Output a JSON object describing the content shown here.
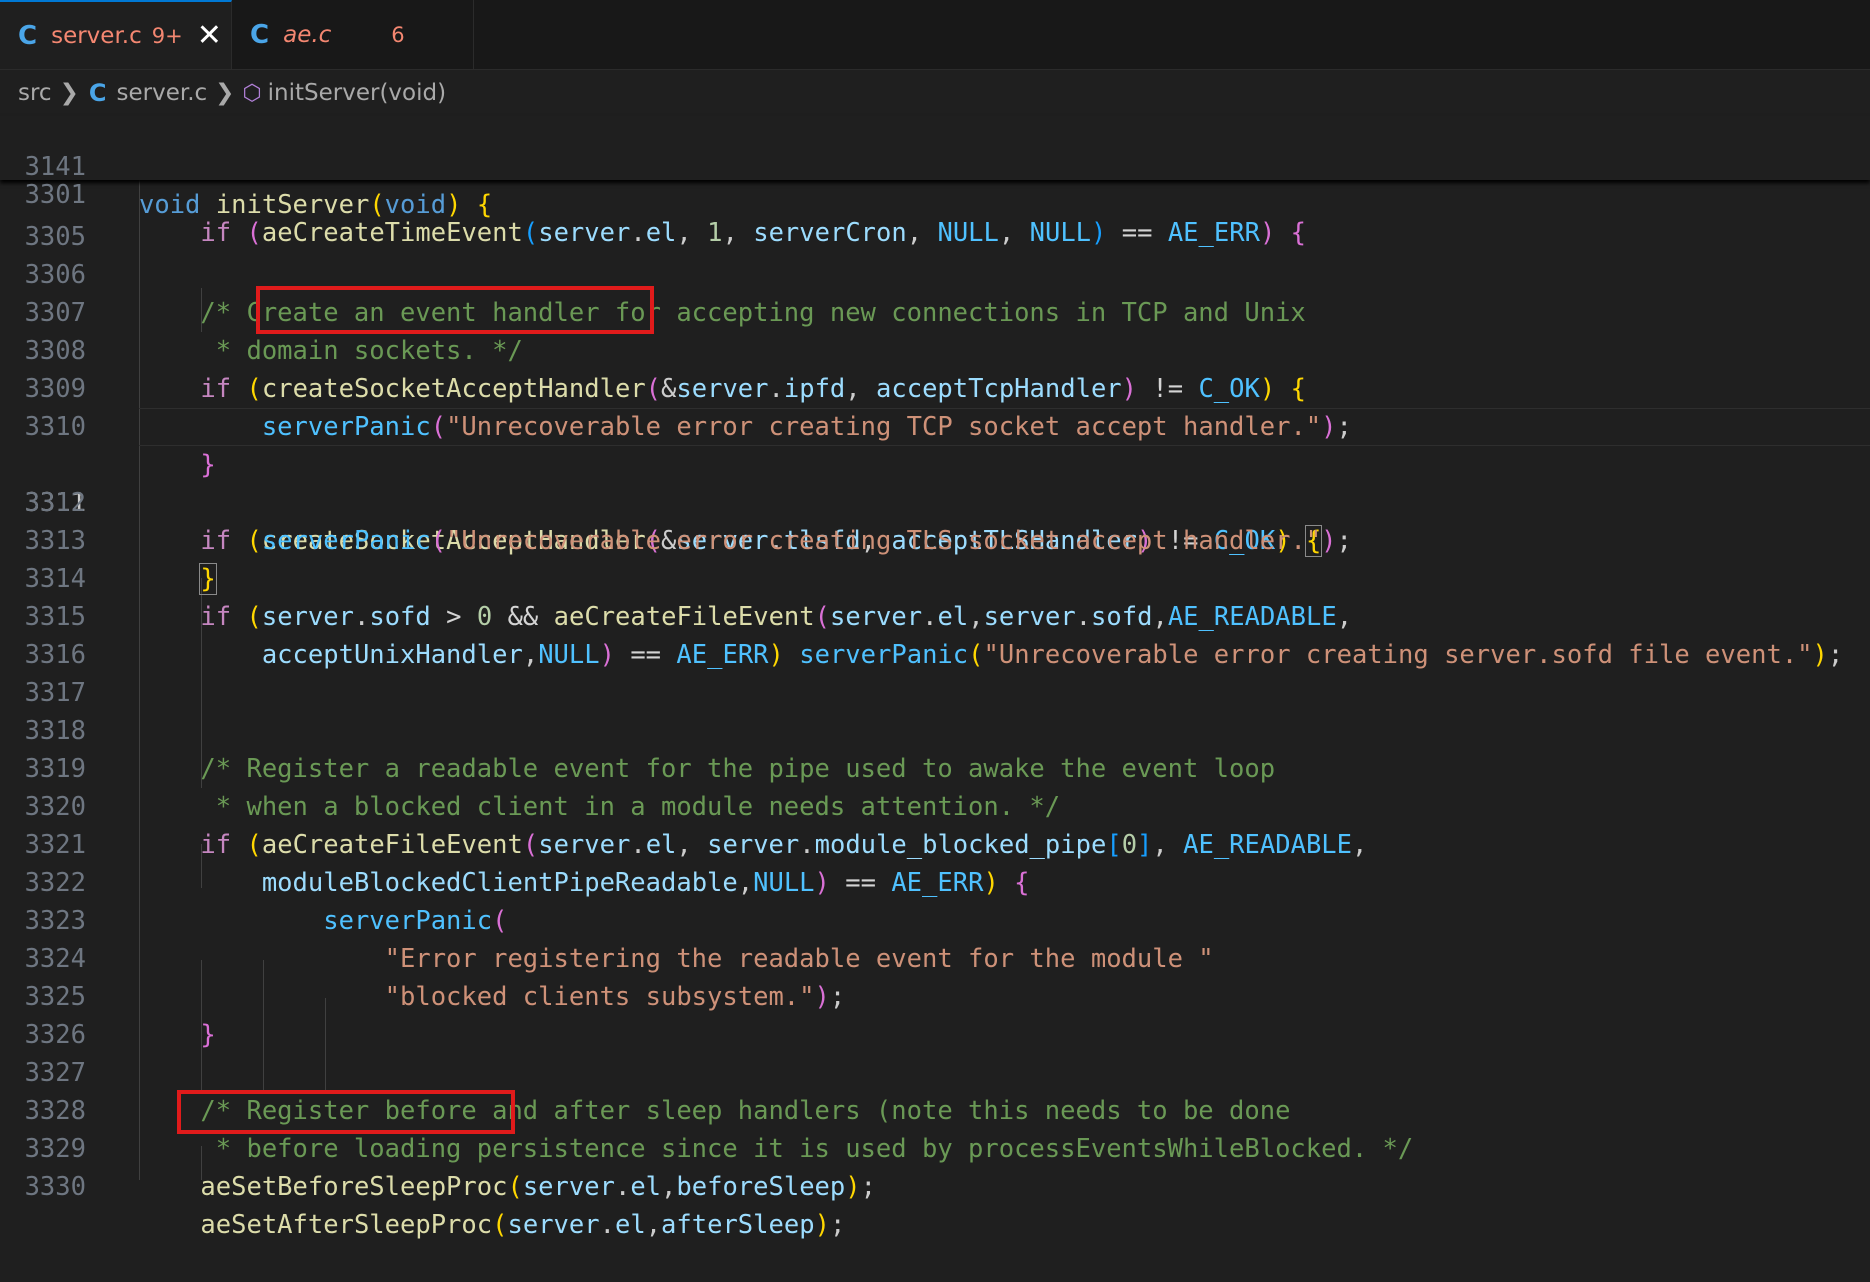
{
  "tabs": [
    {
      "lang_icon": "C",
      "label": "server.c",
      "problems": "9+"
    },
    {
      "lang_icon": "C",
      "label": "ae.c",
      "problems": "6"
    }
  ],
  "breadcrumb": {
    "folder": "src",
    "file_icon": "C",
    "file": "server.c",
    "symbol": "initServer(void)"
  },
  "sticky_lines": [
    {
      "num": "3141"
    },
    {
      "num": "3301"
    }
  ],
  "line_numbers": [
    "3305",
    "3306",
    "3307",
    "3308",
    "3309",
    "3310",
    "3311",
    "3312",
    "3313",
    "3314",
    "3315",
    "3316",
    "3317",
    "3318",
    "3319",
    "3320",
    "3321",
    "3322",
    "3323",
    "3324",
    "3325",
    "3326",
    "3327",
    "3328",
    "3329",
    "3330"
  ],
  "current_line": "3311",
  "highlights": {
    "first": "createSocketAcceptHandler",
    "second": "aeSetBeforeSleepProc"
  },
  "colors": {
    "editor_bg": "#1f1f1f",
    "keyword": "#569cd6",
    "control": "#c586c0",
    "function": "#dcdcaa",
    "variable": "#9cdcfe",
    "comment": "#6a9955",
    "string": "#ce9178",
    "macro": "#4fc1ff",
    "highlight_box": "#e01b1b"
  }
}
